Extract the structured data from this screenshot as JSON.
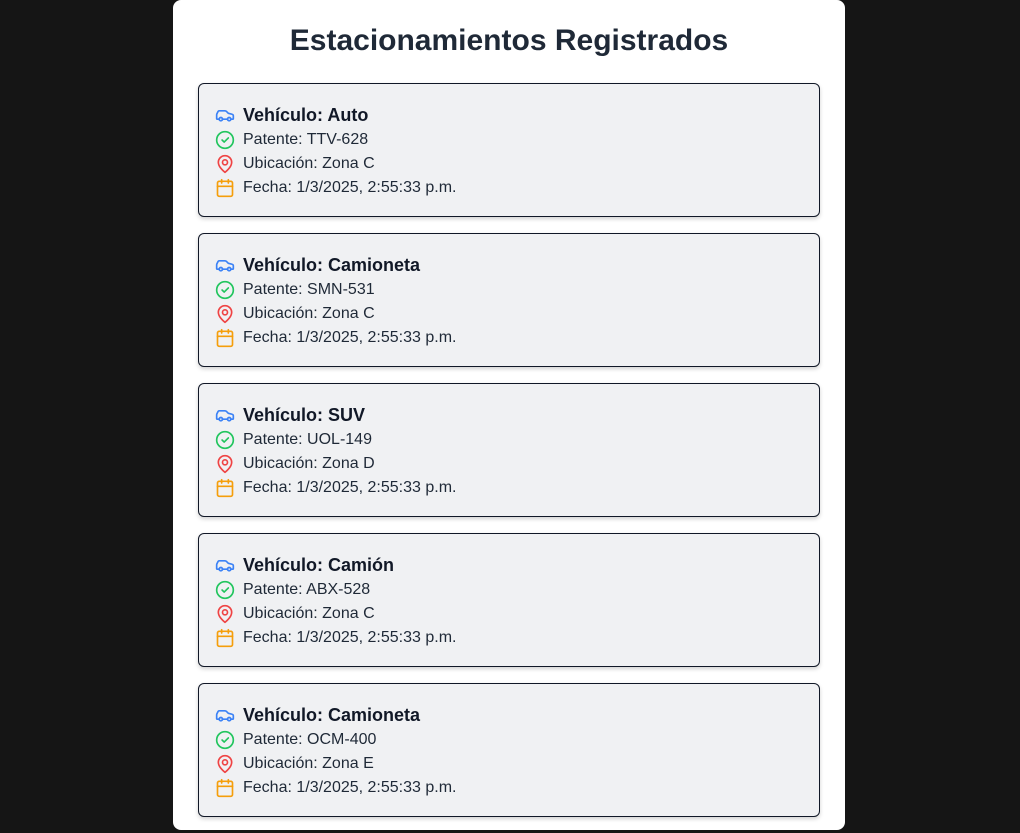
{
  "page": {
    "title": "Estacionamientos Registrados"
  },
  "colors": {
    "car_icon": "#3b82f6",
    "check_icon": "#22c55e",
    "pin_icon": "#ef4444",
    "calendar_icon": "#f59e0b"
  },
  "icons": {
    "vehicle": "car-icon",
    "plate": "check-circle-icon",
    "location": "map-pin-icon",
    "date": "calendar-icon"
  },
  "records": [
    {
      "vehicle": "Vehículo: Auto",
      "plate": "Patente: TTV-628",
      "location": "Ubicación: Zona C",
      "date": "Fecha: 1/3/2025, 2:55:33 p.m."
    },
    {
      "vehicle": "Vehículo: Camioneta",
      "plate": "Patente: SMN-531",
      "location": "Ubicación: Zona C",
      "date": "Fecha: 1/3/2025, 2:55:33 p.m."
    },
    {
      "vehicle": "Vehículo: SUV",
      "plate": "Patente: UOL-149",
      "location": "Ubicación: Zona D",
      "date": "Fecha: 1/3/2025, 2:55:33 p.m."
    },
    {
      "vehicle": "Vehículo: Camión",
      "plate": "Patente: ABX-528",
      "location": "Ubicación: Zona C",
      "date": "Fecha: 1/3/2025, 2:55:33 p.m."
    },
    {
      "vehicle": "Vehículo: Camioneta",
      "plate": "Patente: OCM-400",
      "location": "Ubicación: Zona E",
      "date": "Fecha: 1/3/2025, 2:55:33 p.m."
    }
  ]
}
